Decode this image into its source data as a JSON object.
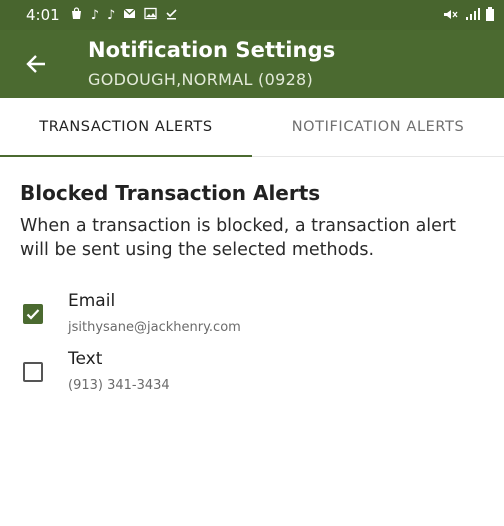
{
  "status_bar": {
    "time": "4:01",
    "icons_left": [
      "shopping-bag-icon",
      "tiktok-icon",
      "tiktok-icon",
      "mail-icon",
      "image-icon",
      "download-done-icon"
    ],
    "icons_right": [
      "mute-icon",
      "lte-signal-icon",
      "battery-icon"
    ]
  },
  "app_bar": {
    "title": "Notification Settings",
    "subtitle": "GODOUGH,NORMAL (0928)",
    "color": "#4b6a30"
  },
  "tabs": [
    {
      "label": "TRANSACTION ALERTS",
      "selected": true
    },
    {
      "label": "NOTIFICATION ALERTS",
      "selected": false
    }
  ],
  "section": {
    "heading": "Blocked Transaction Alerts",
    "description": "When a transaction is blocked, a transaction alert will be sent using the selected methods."
  },
  "options": [
    {
      "label": "Email",
      "value": "jsithysane@jackhenry.com",
      "checked": true
    },
    {
      "label": "Text",
      "value": "(913) 341-3434",
      "checked": false
    }
  ]
}
